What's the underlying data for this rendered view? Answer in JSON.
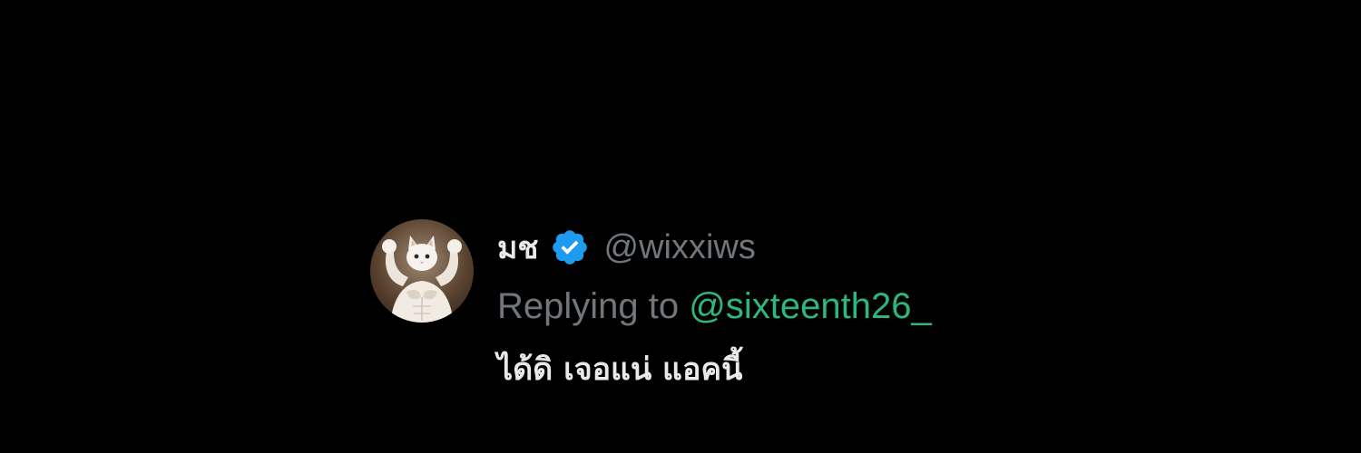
{
  "tweet": {
    "display_name": "มช",
    "handle": "@wixxiws",
    "verified": true,
    "avatar": "muscular-cat-avatar",
    "reply_prefix": "Replying to",
    "reply_to": "@sixteenth26_",
    "text": "ได้ดิ เจอแน่ แอคนี้"
  },
  "colors": {
    "background": "#000000",
    "primary_text": "#e7e9ea",
    "secondary_text": "#71767b",
    "mention": "#2eb67d",
    "verified_badge": "#1d9bf0"
  }
}
